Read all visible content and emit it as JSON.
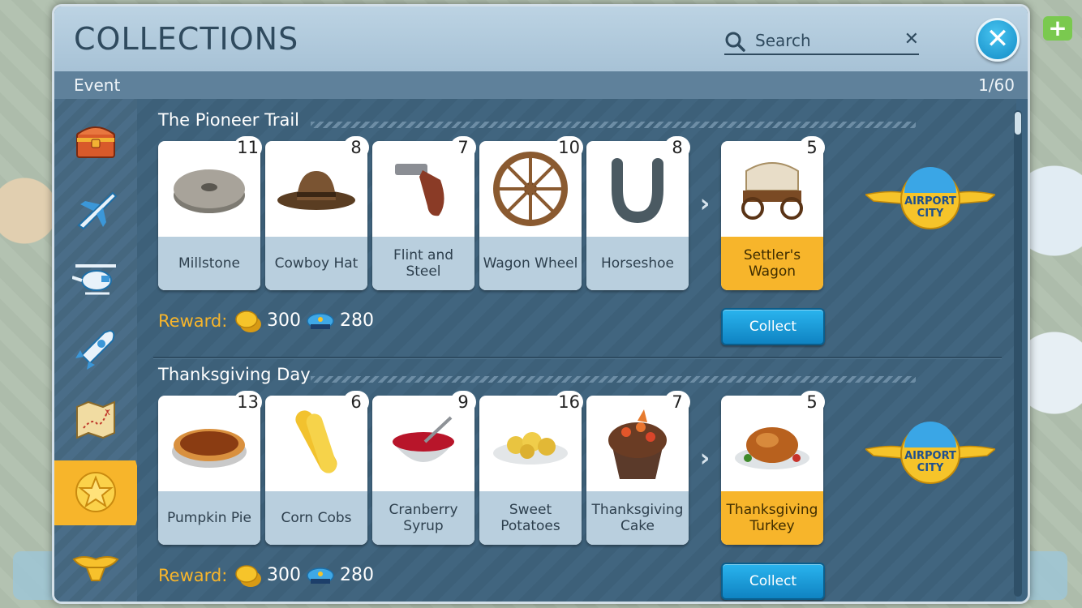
{
  "window": {
    "title": "COLLECTIONS",
    "category": "Event",
    "page_indicator": "1/60"
  },
  "search": {
    "placeholder": "Search",
    "value": "",
    "clear_label": "✕"
  },
  "close_label": "✕",
  "sidebar": {
    "items": [
      {
        "name": "chest",
        "icon": "treasure-chest-icon"
      },
      {
        "name": "airplane",
        "icon": "airplane-icon"
      },
      {
        "name": "helicopter",
        "icon": "helicopter-icon"
      },
      {
        "name": "rocket",
        "icon": "rocket-icon"
      },
      {
        "name": "map",
        "icon": "treasure-map-icon"
      },
      {
        "name": "event",
        "icon": "star-icon",
        "active": true
      },
      {
        "name": "wings",
        "icon": "gold-wings-icon"
      }
    ]
  },
  "collections": [
    {
      "title": "The Pioneer Trail",
      "items": [
        {
          "label": "Millstone",
          "count": "11",
          "icon": "millstone-icon"
        },
        {
          "label": "Cowboy Hat",
          "count": "8",
          "icon": "cowboy-hat-icon"
        },
        {
          "label": "Flint and Steel",
          "count": "7",
          "icon": "flintlock-pistol-icon"
        },
        {
          "label": "Wagon Wheel",
          "count": "10",
          "icon": "wagon-wheel-icon"
        },
        {
          "label": "Horseshoe",
          "count": "8",
          "icon": "horseshoe-icon"
        }
      ],
      "result": {
        "label": "Settler's Wagon",
        "count": "5",
        "icon": "covered-wagon-icon"
      },
      "reward_label": "Reward:",
      "coins": "300",
      "caps": "280",
      "collect_label": "Collect",
      "badge_text": "AIRPORT CITY"
    },
    {
      "title": "Thanksgiving Day",
      "items": [
        {
          "label": "Pumpkin Pie",
          "count": "13",
          "icon": "pie-icon"
        },
        {
          "label": "Corn Cobs",
          "count": "6",
          "icon": "corn-icon"
        },
        {
          "label": "Cranberry Syrup",
          "count": "9",
          "icon": "syrup-bowl-icon"
        },
        {
          "label": "Sweet Potatoes",
          "count": "16",
          "icon": "potatoes-icon"
        },
        {
          "label": "Thanksgiving Cake",
          "count": "7",
          "icon": "cake-icon"
        }
      ],
      "result": {
        "label": "Thanksgiving Turkey",
        "count": "5",
        "icon": "roast-turkey-icon"
      },
      "reward_label": "Reward:",
      "coins": "300",
      "caps": "280",
      "collect_label": "Collect",
      "badge_text": "AIRPORT CITY"
    }
  ]
}
